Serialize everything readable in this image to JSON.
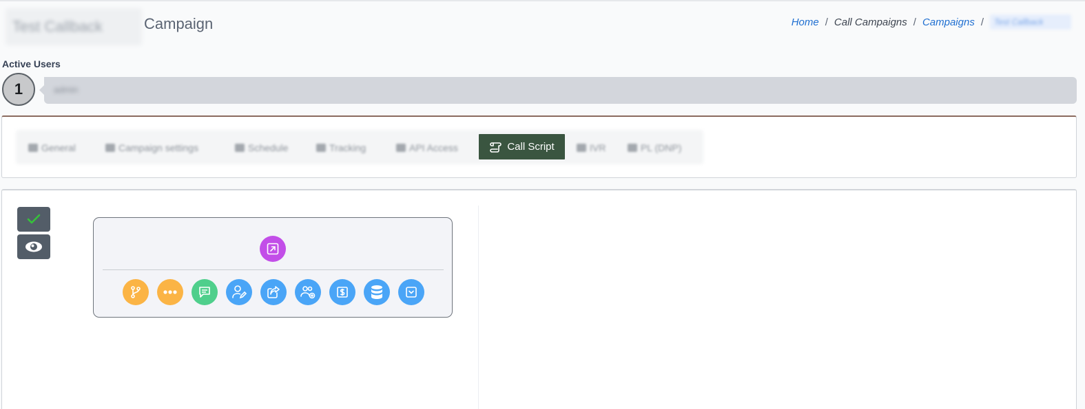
{
  "header": {
    "campaign_name": "Test Callback",
    "title_suffix": "Campaign"
  },
  "breadcrumb": {
    "home": "Home",
    "call_campaigns": "Call Campaigns",
    "campaigns": "Campaigns",
    "current": "Test Callback"
  },
  "active_users": {
    "label": "Active Users",
    "count": "1",
    "users": "admin"
  },
  "tabs": [
    {
      "label": "General",
      "icon": "list-icon"
    },
    {
      "label": "Campaign settings",
      "icon": "list-icon"
    },
    {
      "label": "Schedule",
      "icon": "calendar-icon"
    },
    {
      "label": "Tracking",
      "icon": "list-icon"
    },
    {
      "label": "API Access",
      "icon": "key-icon"
    },
    {
      "label": "Call Script",
      "icon": "scroll-icon",
      "active": true
    },
    {
      "label": "IVR",
      "icon": "ivr-icon"
    },
    {
      "label": "PL (DNP)",
      "icon": "list-icon"
    }
  ],
  "editor": {
    "side_buttons": [
      "check-icon",
      "eye-icon"
    ],
    "node_top_icon": "external-link-icon",
    "node_actions": [
      {
        "icon": "branch-icon",
        "color": "#fbb445"
      },
      {
        "icon": "more-dots-icon",
        "color": "#fbb445"
      },
      {
        "icon": "message-icon",
        "color": "#4fcf8c"
      },
      {
        "icon": "user-edit-icon",
        "color": "#4aa5f7"
      },
      {
        "icon": "share-icon",
        "color": "#4aa5f7"
      },
      {
        "icon": "users-add-icon",
        "color": "#4aa5f7"
      },
      {
        "icon": "dollar-icon",
        "color": "#4aa5f7"
      },
      {
        "icon": "database-icon",
        "color": "#4aa5f7"
      },
      {
        "icon": "dropdown-box-icon",
        "color": "#4aa5f7"
      }
    ]
  },
  "colors": {
    "active_tab": "#3a5540",
    "link": "#1f6fd1",
    "check": "#36c23a",
    "purple": "#c24ee8"
  }
}
